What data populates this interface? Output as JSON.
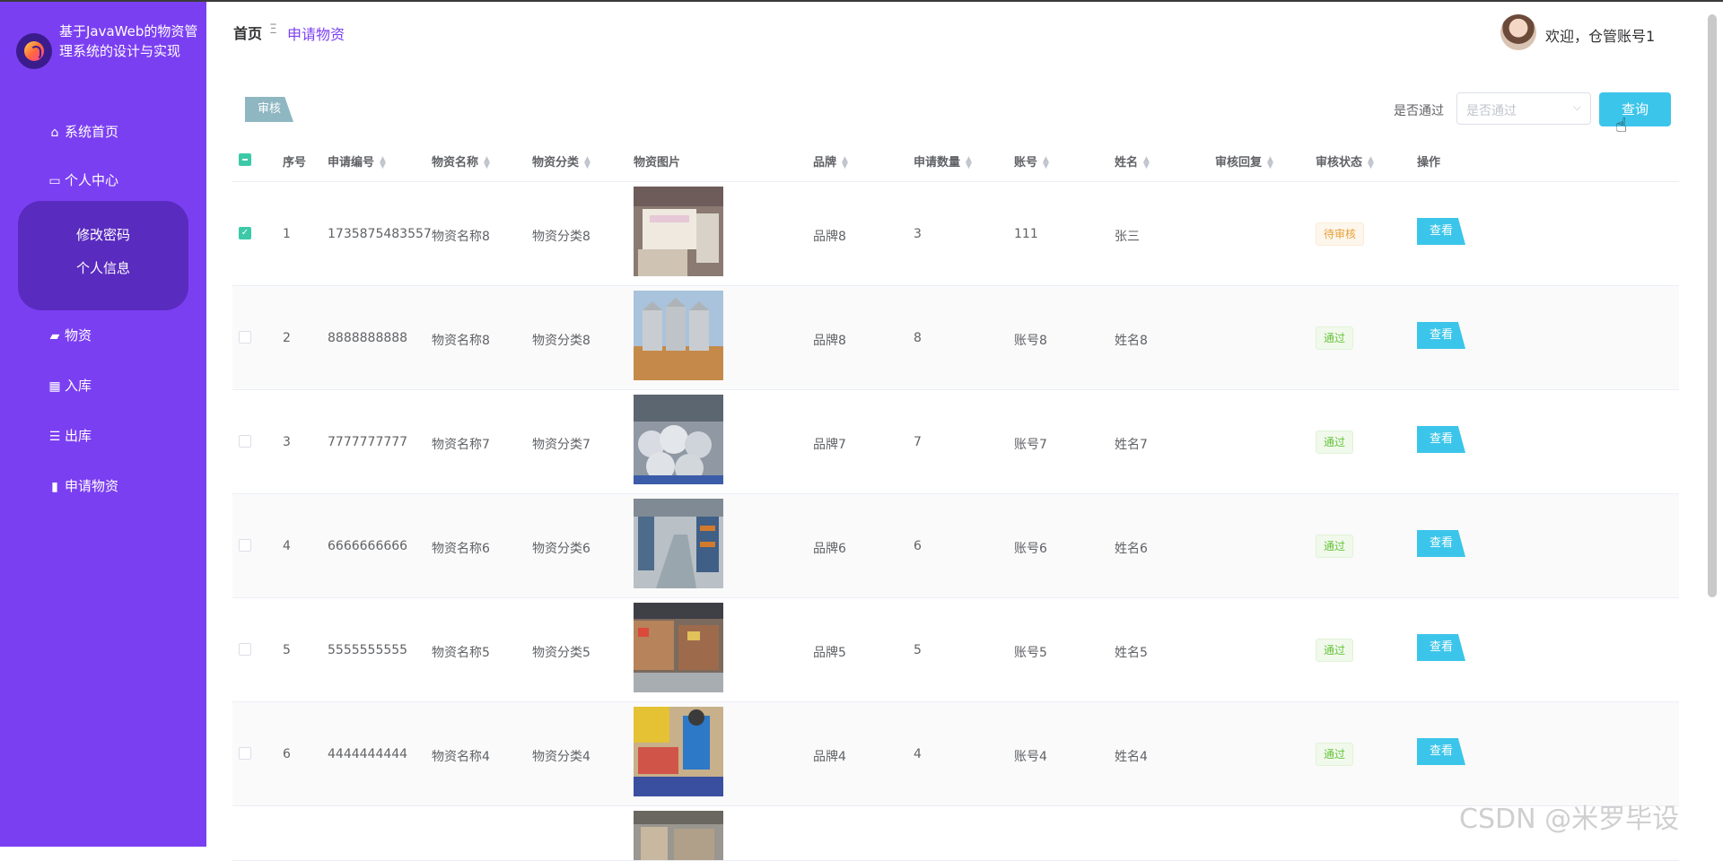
{
  "app": {
    "title": "基于JavaWeb的物资管理系统的设计与实现"
  },
  "sidebar": {
    "items": [
      {
        "label": "系统首页",
        "icon": "home-icon"
      },
      {
        "label": "个人中心",
        "icon": "card-icon"
      },
      {
        "label": "物资",
        "icon": "folder-icon"
      },
      {
        "label": "入库",
        "icon": "grid-icon"
      },
      {
        "label": "出库",
        "icon": "list-icon"
      },
      {
        "label": "申请物资",
        "icon": "bar-chart-icon"
      }
    ],
    "submenu": [
      "修改密码",
      "个人信息"
    ]
  },
  "header": {
    "breadcrumb_home": "首页",
    "breadcrumb_sep": "Ξ",
    "breadcrumb_current": "申请物资",
    "welcome": "欢迎，仓管账号1"
  },
  "toolbar": {
    "audit_label": "审核",
    "filter_label": "是否通过",
    "filter_placeholder": "是否通过",
    "query_label": "查询"
  },
  "table": {
    "columns": [
      "序号",
      "申请编号",
      "物资名称",
      "物资分类",
      "物资图片",
      "品牌",
      "申请数量",
      "账号",
      "姓名",
      "审核回复",
      "审核状态",
      "操作"
    ],
    "rows": [
      {
        "checked": true,
        "index": "1",
        "apply_no": "1735875483557",
        "name": "物资名称8",
        "category": "物资分类8",
        "brand": "品牌8",
        "qty": "3",
        "account": "111",
        "person": "张三",
        "reply": "",
        "status": "待审核",
        "status_type": "pending",
        "action": "查看"
      },
      {
        "checked": false,
        "index": "2",
        "apply_no": "8888888888",
        "name": "物资名称8",
        "category": "物资分类8",
        "brand": "品牌8",
        "qty": "8",
        "account": "账号8",
        "person": "姓名8",
        "reply": "",
        "status": "通过",
        "status_type": "pass",
        "action": "查看"
      },
      {
        "checked": false,
        "index": "3",
        "apply_no": "7777777777",
        "name": "物资名称7",
        "category": "物资分类7",
        "brand": "品牌7",
        "qty": "7",
        "account": "账号7",
        "person": "姓名7",
        "reply": "",
        "status": "通过",
        "status_type": "pass",
        "action": "查看"
      },
      {
        "checked": false,
        "index": "4",
        "apply_no": "6666666666",
        "name": "物资名称6",
        "category": "物资分类6",
        "brand": "品牌6",
        "qty": "6",
        "account": "账号6",
        "person": "姓名6",
        "reply": "",
        "status": "通过",
        "status_type": "pass",
        "action": "查看"
      },
      {
        "checked": false,
        "index": "5",
        "apply_no": "5555555555",
        "name": "物资名称5",
        "category": "物资分类5",
        "brand": "品牌5",
        "qty": "5",
        "account": "账号5",
        "person": "姓名5",
        "reply": "",
        "status": "通过",
        "status_type": "pass",
        "action": "查看"
      },
      {
        "checked": false,
        "index": "6",
        "apply_no": "4444444444",
        "name": "物资名称4",
        "category": "物资分类4",
        "brand": "品牌4",
        "qty": "4",
        "account": "账号4",
        "person": "姓名4",
        "reply": "",
        "status": "通过",
        "status_type": "pass",
        "action": "查看"
      }
    ]
  },
  "watermark": "CSDN @米罗毕设",
  "colors": {
    "sidebar": "#7b3ff2",
    "submenu": "#5a2bbf",
    "accent_button": "#3cc5ea",
    "checkbox": "#3cc9a8"
  }
}
